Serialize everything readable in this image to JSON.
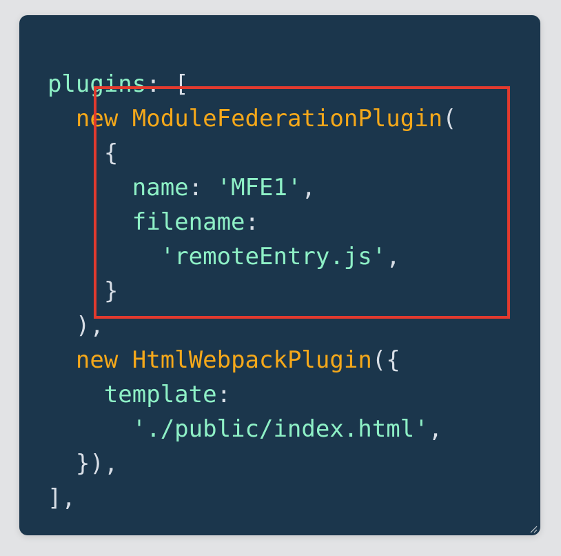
{
  "code": {
    "lines": [
      {
        "indent": "  ",
        "tokens": [
          {
            "t": "plugins",
            "c": "ident"
          },
          {
            "t": ": [",
            "c": "punc"
          }
        ]
      },
      {
        "indent": "    ",
        "tokens": [
          {
            "t": "new",
            "c": "kw"
          },
          {
            "t": " ",
            "c": "punc"
          },
          {
            "t": "ModuleFederationPlugin",
            "c": "cls"
          },
          {
            "t": "(",
            "c": "punc"
          }
        ]
      },
      {
        "indent": "      ",
        "tokens": [
          {
            "t": "{",
            "c": "punc"
          }
        ]
      },
      {
        "indent": "        ",
        "tokens": [
          {
            "t": "name",
            "c": "ident"
          },
          {
            "t": ": ",
            "c": "punc"
          },
          {
            "t": "'MFE1'",
            "c": "str"
          },
          {
            "t": ",",
            "c": "punc"
          }
        ]
      },
      {
        "indent": "        ",
        "tokens": [
          {
            "t": "filename",
            "c": "ident"
          },
          {
            "t": ":",
            "c": "punc"
          }
        ]
      },
      {
        "indent": "          ",
        "tokens": [
          {
            "t": "'remoteEntry.js'",
            "c": "str"
          },
          {
            "t": ",",
            "c": "punc"
          }
        ]
      },
      {
        "indent": "      ",
        "tokens": [
          {
            "t": "}",
            "c": "punc"
          }
        ]
      },
      {
        "indent": "    ",
        "tokens": [
          {
            "t": "),",
            "c": "punc"
          }
        ]
      },
      {
        "indent": "    ",
        "tokens": [
          {
            "t": "new",
            "c": "kw"
          },
          {
            "t": " ",
            "c": "punc"
          },
          {
            "t": "HtmlWebpackPlugin",
            "c": "cls"
          },
          {
            "t": "({",
            "c": "punc"
          }
        ]
      },
      {
        "indent": "      ",
        "tokens": [
          {
            "t": "template",
            "c": "ident"
          },
          {
            "t": ":",
            "c": "punc"
          }
        ]
      },
      {
        "indent": "        ",
        "tokens": [
          {
            "t": "'./public/index.html'",
            "c": "str"
          },
          {
            "t": ",",
            "c": "punc"
          }
        ]
      },
      {
        "indent": "    ",
        "tokens": [
          {
            "t": "}),",
            "c": "punc"
          }
        ]
      },
      {
        "indent": "  ",
        "tokens": [
          {
            "t": "],",
            "c": "punc"
          }
        ]
      }
    ]
  },
  "colors": {
    "background": "#1b364c",
    "identifier": "#8ef0c6",
    "keyword": "#f5a81a",
    "punctuation": "#d8dee6",
    "highlight_border": "#e23a2e"
  },
  "highlight": {
    "description_lines": [
      1,
      7
    ]
  },
  "icons": {
    "resize_grip": "resize-grip-icon"
  }
}
